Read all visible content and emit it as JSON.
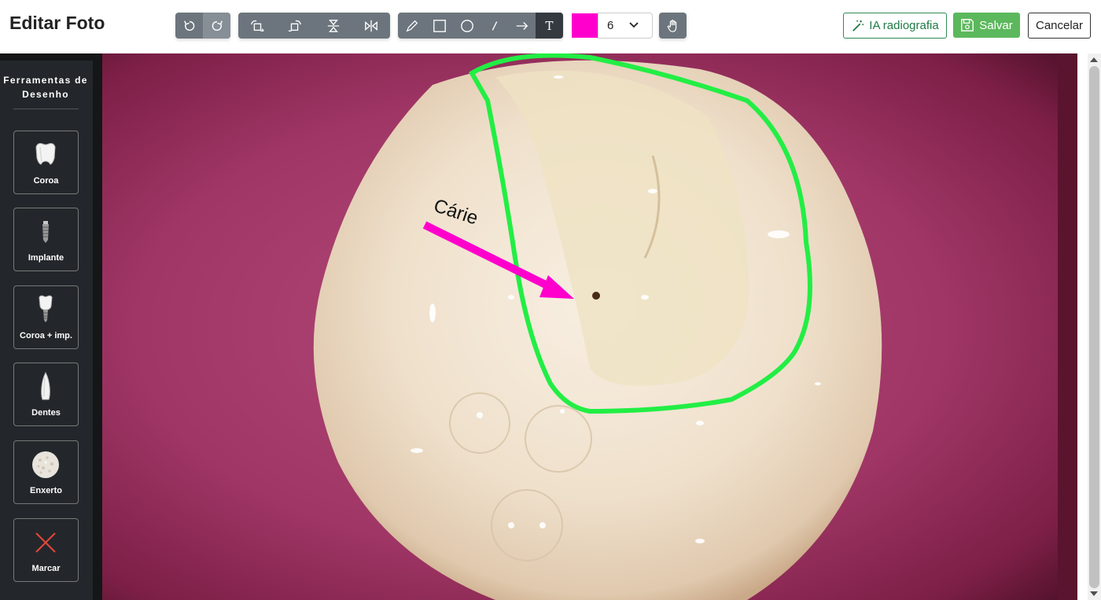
{
  "header": {
    "title": "Editar Foto",
    "rotate_group": [
      "rotate-left-icon",
      "rotate-right-icon"
    ],
    "transform_group": [
      "crop-rotate-left-icon",
      "crop-rotate-right-icon",
      "flip-vertical-icon",
      "flip-horizontal-icon"
    ],
    "draw_group": [
      "pencil-icon",
      "rectangle-icon",
      "circle-icon",
      "line-icon",
      "arrow-icon"
    ],
    "text_tool_glyph": "T",
    "color_hex": "#ff00cc",
    "stroke_size": "6",
    "pan_icon": "hand-icon",
    "ia_label": "IA radiografia",
    "save_label": "Salvar",
    "cancel_label": "Cancelar"
  },
  "sidebar": {
    "title": "Ferramentas de Desenho",
    "tools": [
      {
        "label": "Coroa",
        "icon": "crown-icon"
      },
      {
        "label": "Implante",
        "icon": "implant-icon"
      },
      {
        "label": "Coroa + imp.",
        "icon": "crown-implant-icon"
      },
      {
        "label": "Dentes",
        "icon": "tooth-icon"
      },
      {
        "label": "Enxerto",
        "icon": "graft-icon"
      },
      {
        "label": "Marcar",
        "icon": "x-mark-icon"
      }
    ]
  },
  "canvas": {
    "annotation_text": "Cárie",
    "arrow_color": "#ff00cc",
    "outline_color": "#22ee44"
  }
}
